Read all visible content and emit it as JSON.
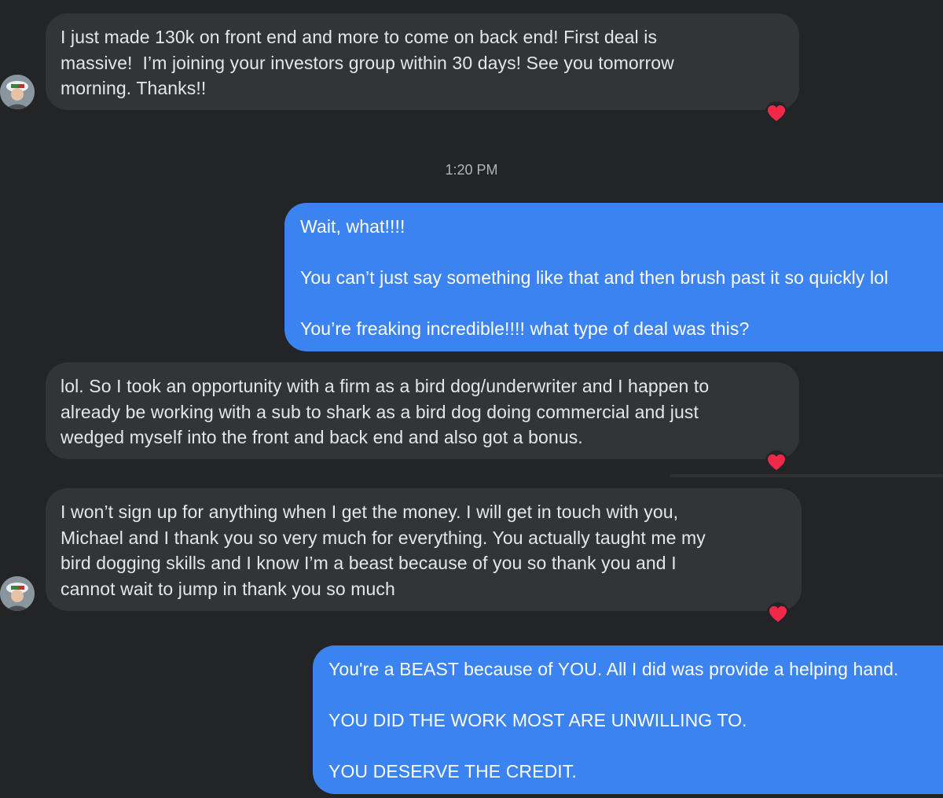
{
  "timestamp": "1:20 PM",
  "messages": [
    {
      "direction": "incoming",
      "lines": [
        "I just made 130k on front end and more to come on back end! First deal is",
        "massive!  I’m joining your investors group within 30 days! See you tomorrow",
        "morning. Thanks!!"
      ],
      "reaction": "heart"
    },
    {
      "direction": "outgoing",
      "lines": [
        "Wait, what!!!!",
        "",
        "You can’t just say something like that and then brush past it so quickly lol",
        "",
        "You’re freaking incredible!!!! what type of deal was this?"
      ]
    },
    {
      "direction": "incoming",
      "lines": [
        "lol. So I took an opportunity with a firm as a bird dog/underwriter and I happen to",
        "already be working with a sub to shark as a bird dog doing commercial and just",
        "wedged myself into the front and back end and also got a bonus."
      ],
      "reaction": "heart"
    },
    {
      "direction": "incoming",
      "lines": [
        "I won’t sign up for anything when I get the money. I will get in touch with you,",
        "Michael and I thank you so very much for everything. You actually taught me my",
        "bird dogging skills and I know I’m a beast because of you so thank you and I",
        "cannot wait to jump in thank you so much"
      ],
      "reaction": "heart"
    },
    {
      "direction": "outgoing",
      "lines": [
        "You're a BEAST because of YOU. All I did was provide a helping hand.",
        "",
        "YOU DID THE WORK MOST ARE UNWILLING TO.",
        "",
        "YOU DESERVE THE CREDIT."
      ]
    }
  ],
  "icons": {
    "avatar": "contact-avatar-icon",
    "reaction": "heart-reaction-icon"
  },
  "colors": {
    "background": "#232425",
    "incoming_bubble": "#333436",
    "outgoing_bubble": "#3b83f1",
    "heart": "#f02849"
  }
}
